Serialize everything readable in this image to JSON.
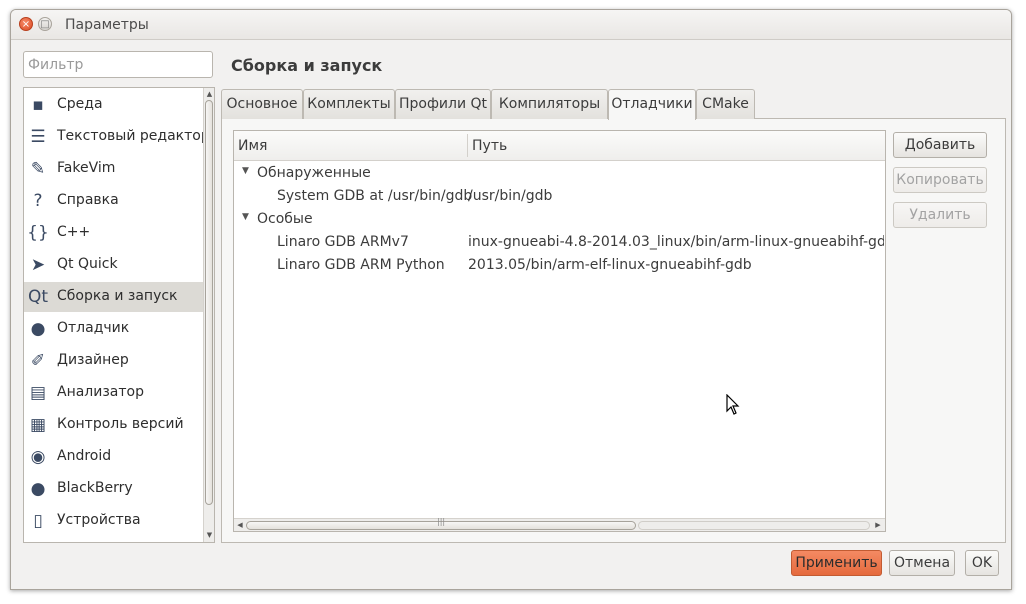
{
  "window": {
    "title": "Параметры",
    "close_glyph": "×",
    "min_glyph": "□"
  },
  "filter": {
    "placeholder": "Фильтр",
    "value": ""
  },
  "categories": [
    {
      "label": "Среда",
      "icon": "monitor-icon",
      "glyph": "▪"
    },
    {
      "label": "Текстовый редактор",
      "icon": "text-editor-icon",
      "glyph": "☰"
    },
    {
      "label": "FakeVim",
      "icon": "fakevim-icon",
      "glyph": "✎"
    },
    {
      "label": "Справка",
      "icon": "help-icon",
      "glyph": "?"
    },
    {
      "label": "C++",
      "icon": "cpp-braces-icon",
      "glyph": "{}"
    },
    {
      "label": "Qt Quick",
      "icon": "paper-plane-icon",
      "glyph": "➤"
    },
    {
      "label": "Сборка и запуск",
      "icon": "build-run-icon",
      "glyph": "Qt"
    },
    {
      "label": "Отладчик",
      "icon": "debugger-icon",
      "glyph": "●"
    },
    {
      "label": "Дизайнер",
      "icon": "designer-icon",
      "glyph": "✐"
    },
    {
      "label": "Анализатор",
      "icon": "analyzer-icon",
      "glyph": "▤"
    },
    {
      "label": "Контроль версий",
      "icon": "version-control-icon",
      "glyph": "▦"
    },
    {
      "label": "Android",
      "icon": "android-icon",
      "glyph": "◉"
    },
    {
      "label": "BlackBerry",
      "icon": "blackberry-icon",
      "glyph": "●"
    },
    {
      "label": "Устройства",
      "icon": "devices-icon",
      "glyph": "▯"
    }
  ],
  "selected_category": "Сборка и запуск",
  "page": {
    "title": "Сборка и запуск"
  },
  "tabs": [
    {
      "label": "Основное"
    },
    {
      "label": "Комплекты"
    },
    {
      "label": "Профили Qt"
    },
    {
      "label": "Компиляторы"
    },
    {
      "label": "Отладчики"
    },
    {
      "label": "CMake"
    }
  ],
  "active_tab": "Отладчики",
  "tree": {
    "columns": [
      "Имя",
      "Путь"
    ],
    "groups": [
      {
        "label": "Обнаруженные",
        "expanded": true,
        "items": [
          {
            "name": "System GDB at /usr/bin/gdb",
            "path": "/usr/bin/gdb"
          }
        ]
      },
      {
        "label": "Особые",
        "expanded": true,
        "items": [
          {
            "name": "Linaro GDB ARMv7",
            "path": "inux-gnueabi-4.8-2014.03_linux/bin/arm-linux-gnueabihf-gdb"
          },
          {
            "name": "Linaro GDB ARM Python",
            "path": "2013.05/bin/arm-elf-linux-gnueabihf-gdb"
          }
        ]
      }
    ]
  },
  "side_buttons": {
    "add": "Добавить",
    "copy": "Копировать",
    "remove": "Удалить"
  },
  "footer": {
    "apply": "Применить",
    "cancel": "Отмена",
    "ok": "OK"
  },
  "colors": {
    "apply_button": "#e56a3d",
    "close_button": "#dc4a23",
    "selection": "#dcdad5"
  }
}
